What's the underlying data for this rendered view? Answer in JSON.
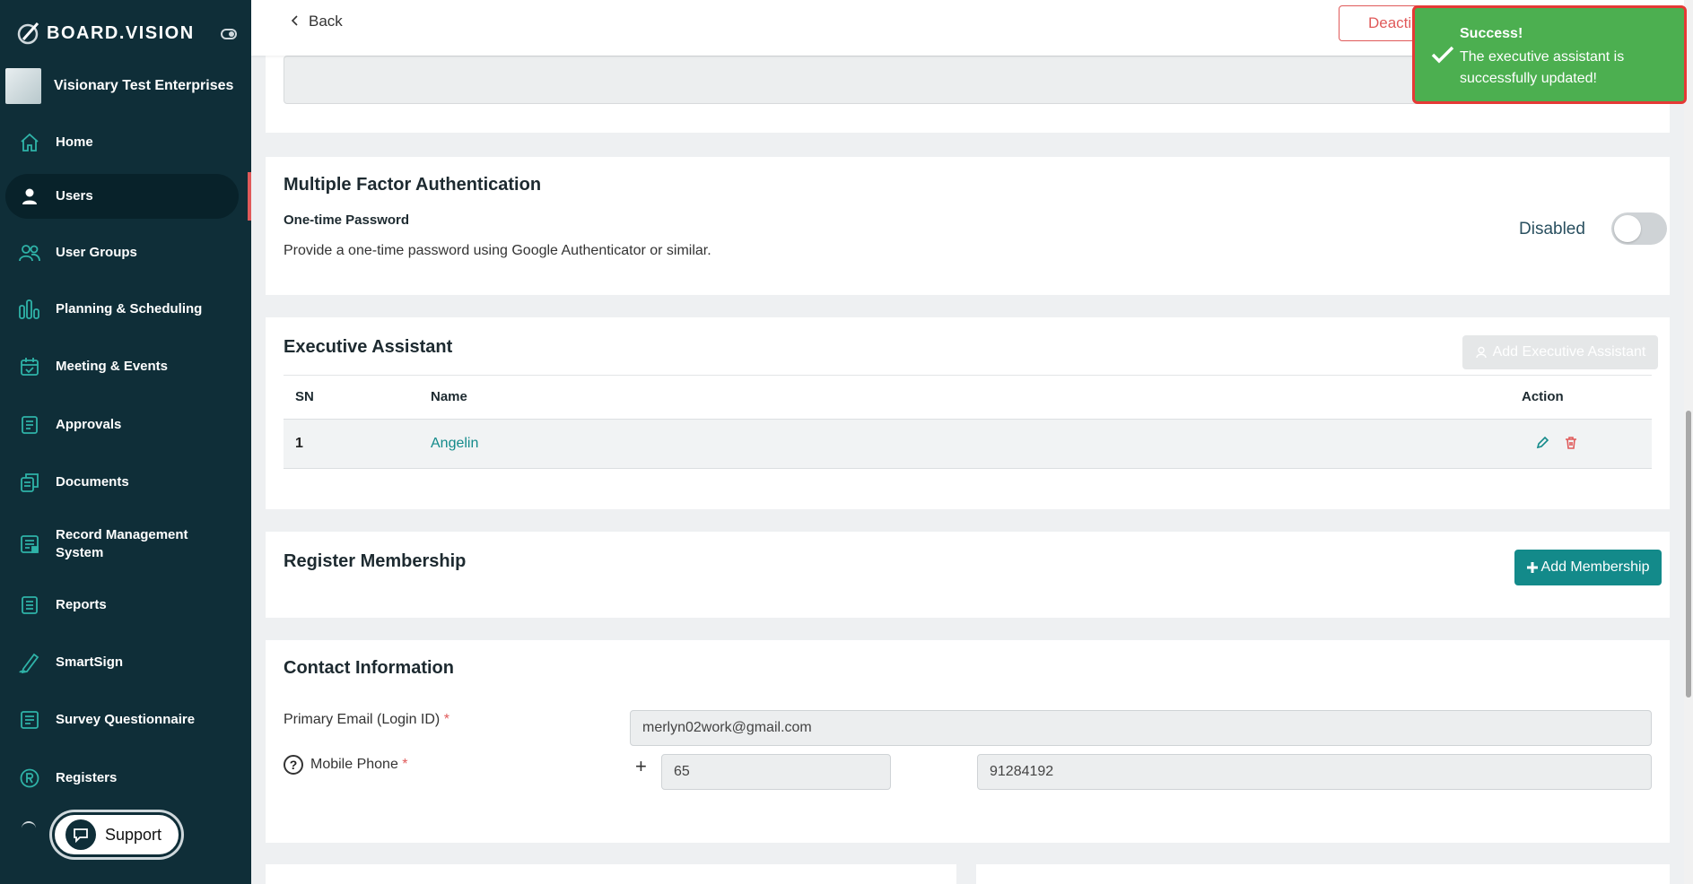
{
  "brand": {
    "name": "BOARD.VISION"
  },
  "organization": {
    "name": "Visionary Test Enterprises"
  },
  "sidebar": {
    "items": [
      {
        "label": "Home",
        "icon": "home-icon"
      },
      {
        "label": "Users",
        "icon": "user-icon",
        "active": true
      },
      {
        "label": "User Groups",
        "icon": "users-icon"
      },
      {
        "label": "Planning & Scheduling",
        "icon": "bar-chart-icon"
      },
      {
        "label": "Meeting & Events",
        "icon": "calendar-check-icon"
      },
      {
        "label": "Approvals",
        "icon": "approvals-icon"
      },
      {
        "label": "Documents",
        "icon": "documents-icon"
      },
      {
        "label": "Record Management System",
        "icon": "records-icon"
      },
      {
        "label": "Reports",
        "icon": "reports-icon"
      },
      {
        "label": "SmartSign",
        "icon": "pen-icon"
      },
      {
        "label": "Survey Questionnaire",
        "icon": "survey-icon"
      },
      {
        "label": "Registers",
        "icon": "registered-icon"
      }
    ],
    "support_label": "Support"
  },
  "topbar": {
    "back_label": "Back",
    "deactivate_label": "Deacti"
  },
  "mfa": {
    "title": "Multiple Factor Authentication",
    "subtitle": "One-time Password",
    "description": "Provide a one-time password using Google Authenticator or similar.",
    "status_label": "Disabled",
    "enabled": false
  },
  "executive_assistant": {
    "title": "Executive Assistant",
    "add_button_label": "Add Executive Assistant",
    "columns": {
      "sn": "SN",
      "name": "Name",
      "action": "Action"
    },
    "rows": [
      {
        "sn": "1",
        "name": "Angelin"
      }
    ]
  },
  "membership": {
    "title": "Register Membership",
    "add_button_label": "Add Membership"
  },
  "contact": {
    "title": "Contact Information",
    "email_label": "Primary Email (Login ID)",
    "email_value": "merlyn02work@gmail.com",
    "mobile_label": "Mobile Phone",
    "country_code": "65",
    "mobile_value": "91284192",
    "required_mark": "*",
    "plus_sign": "+",
    "help_glyph": "?"
  },
  "toast": {
    "title": "Success!",
    "message": "The executive assistant is successfully updated!"
  },
  "colors": {
    "sidebar_bg": "#0f2e38",
    "accent": "#138a8a",
    "danger": "#e05a5a",
    "success": "#4caf50"
  }
}
